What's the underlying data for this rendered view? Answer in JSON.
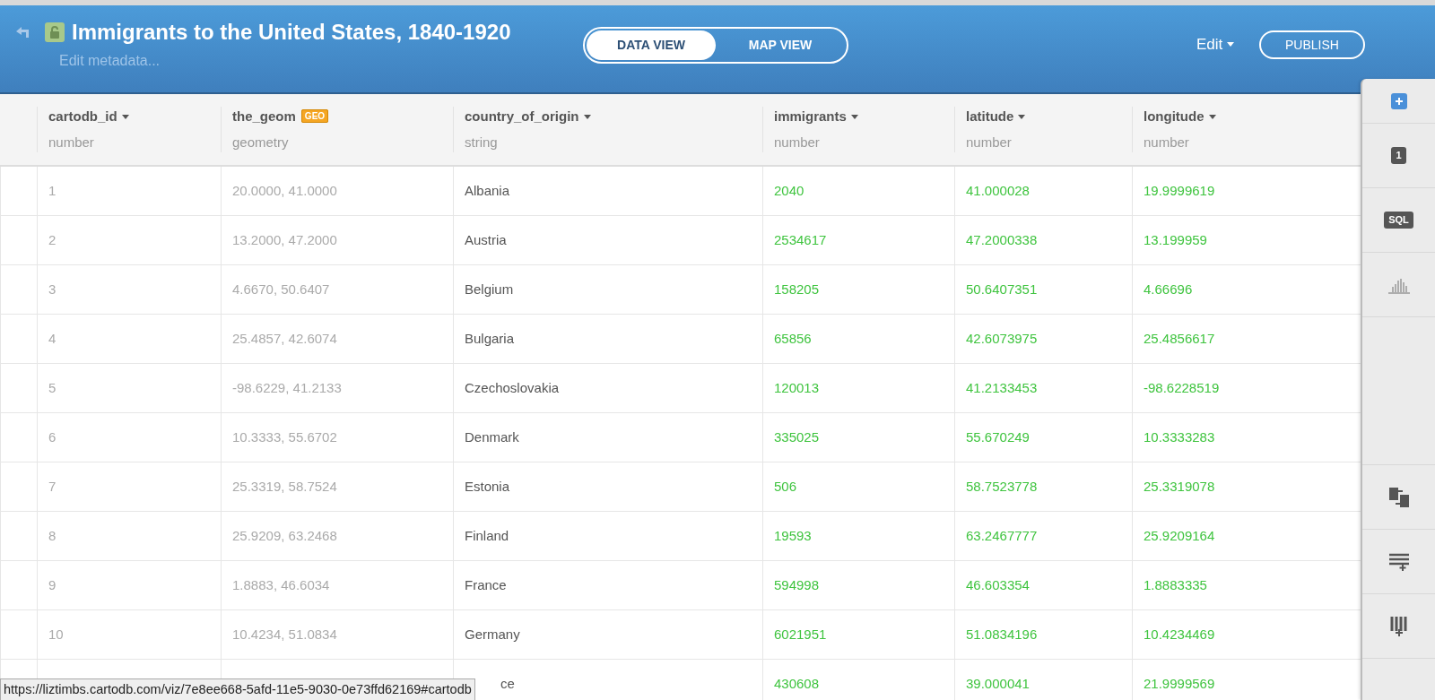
{
  "header": {
    "title": "Immigrants to the United States, 1840-1920",
    "subtitle": "Edit metadata...",
    "view_tabs": [
      {
        "label": "DATA VIEW",
        "selected": true
      },
      {
        "label": "MAP VIEW",
        "selected": false
      }
    ],
    "edit_menu": "Edit",
    "publish_button": "PUBLISH"
  },
  "table": {
    "columns": [
      {
        "name": "cartodb_id",
        "type": "number",
        "kind": "id"
      },
      {
        "name": "the_geom",
        "type": "geometry",
        "kind": "geom",
        "badge": "GEO"
      },
      {
        "name": "country_of_origin",
        "type": "string",
        "kind": "text"
      },
      {
        "name": "immigrants",
        "type": "number",
        "kind": "number"
      },
      {
        "name": "latitude",
        "type": "number",
        "kind": "number"
      },
      {
        "name": "longitude",
        "type": "number",
        "kind": "number"
      }
    ],
    "rows": [
      [
        "1",
        "20.0000, 41.0000",
        "Albania",
        "2040",
        "41.000028",
        "19.9999619"
      ],
      [
        "2",
        "13.2000, 47.2000",
        "Austria",
        "2534617",
        "47.2000338",
        "13.199959"
      ],
      [
        "3",
        "4.6670, 50.6407",
        "Belgium",
        "158205",
        "50.6407351",
        "4.66696"
      ],
      [
        "4",
        "25.4857, 42.6074",
        "Bulgaria",
        "65856",
        "42.6073975",
        "25.4856617"
      ],
      [
        "5",
        "-98.6229, 41.2133",
        "Czechoslovakia",
        "120013",
        "41.2133453",
        "-98.6228519"
      ],
      [
        "6",
        "10.3333, 55.6702",
        "Denmark",
        "335025",
        "55.670249",
        "10.3333283"
      ],
      [
        "7",
        "25.3319, 58.7524",
        "Estonia",
        "506",
        "58.7523778",
        "25.3319078"
      ],
      [
        "8",
        "25.9209, 63.2468",
        "Finland",
        "19593",
        "63.2467777",
        "25.9209164"
      ],
      [
        "9",
        "1.8883, 46.6034",
        "France",
        "594998",
        "46.603354",
        "1.8883335"
      ],
      [
        "10",
        "10.4234, 51.0834",
        "Germany",
        "6021951",
        "51.0834196",
        "10.4234469"
      ],
      [
        null,
        null,
        "ce",
        "430608",
        "39.000041",
        "21.9999569"
      ]
    ]
  },
  "sidebar": {
    "items": [
      {
        "kind": "add"
      },
      {
        "kind": "badge",
        "label": "1"
      },
      {
        "kind": "badge",
        "label": "SQL"
      },
      {
        "kind": "histogram"
      },
      {
        "kind": "spacer"
      },
      {
        "kind": "merge"
      },
      {
        "kind": "add-row"
      },
      {
        "kind": "add-column"
      }
    ]
  },
  "status_url": "https://liztimbs.cartodb.com/viz/7e8ee668-5afd-11e5-9030-0e73ffd62169#cartodb"
}
